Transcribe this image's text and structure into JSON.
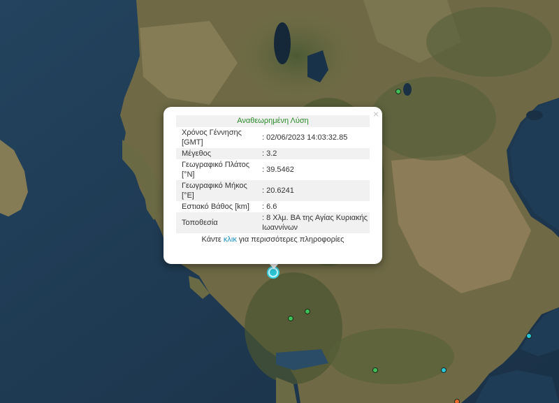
{
  "map": {
    "markers": [
      {
        "id": "m1",
        "color": "green"
      },
      {
        "id": "m2",
        "color": "green"
      },
      {
        "id": "m3",
        "color": "green"
      },
      {
        "id": "m4",
        "color": "green"
      },
      {
        "id": "m5",
        "color": "cyan"
      },
      {
        "id": "m6",
        "color": "cyan"
      },
      {
        "id": "m7",
        "color": "orange"
      },
      {
        "id": "selected",
        "color": "cyan"
      }
    ]
  },
  "popup": {
    "header": "Αναθεωρημένη Λύση",
    "close_symbol": "×",
    "rows": [
      {
        "label": "Χρόνος Γέννησης [GMT]",
        "value": ": 02/06/2023 14:03:32.85"
      },
      {
        "label": "Μέγεθος",
        "value": ": 3.2"
      },
      {
        "label": "Γεωγραφικό Πλάτος [°N]",
        "value": ": 39.5462"
      },
      {
        "label": "Γεωγραφικό Μήκος [°E]",
        "value": ": 20.6241"
      },
      {
        "label": "Εστιακό Βάθος [km]",
        "value": ": 6.6"
      },
      {
        "label": "Τοποθεσία",
        "value": ": 8 Χλμ. ΒΑ της Αγίας Κυριακής Ιωαννίνων"
      }
    ],
    "more_prefix": "Κάντε ",
    "more_link": "κλικ",
    "more_suffix": " για περισσότερες πληροφορίες"
  }
}
